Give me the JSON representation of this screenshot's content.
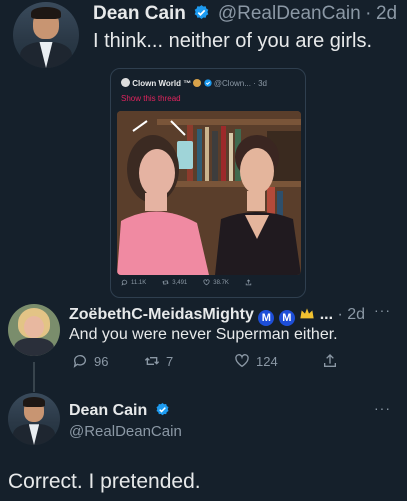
{
  "tweet1": {
    "name": "Dean Cain",
    "handle": "@RealDeanCain",
    "sep": "·",
    "time": "2d",
    "text": "I think... neither of you are girls."
  },
  "quote": {
    "name": "Clown World ™",
    "handle": "@Clown...",
    "sep": "·",
    "time": "3d",
    "show_thread": "Show this thread",
    "replies": "11.1K",
    "retweets": "3,491",
    "likes": "38.7K"
  },
  "reply": {
    "name": "ZoëbethC-MeidasMighty",
    "badges": [
      "M",
      "M"
    ],
    "ellipsis": "...",
    "sep": "·",
    "time": "2d",
    "text": "And you were never Superman either.",
    "replies": "96",
    "retweets": "7",
    "likes": "124"
  },
  "main": {
    "name": "Dean Cain",
    "handle": "@RealDeanCain",
    "text": "Correct. I pretended."
  },
  "colors": {
    "background": "#15202b",
    "verified": "#1d9bf0",
    "secondary_text": "#8b98a5",
    "badge_blue": "#1d4ed8"
  }
}
